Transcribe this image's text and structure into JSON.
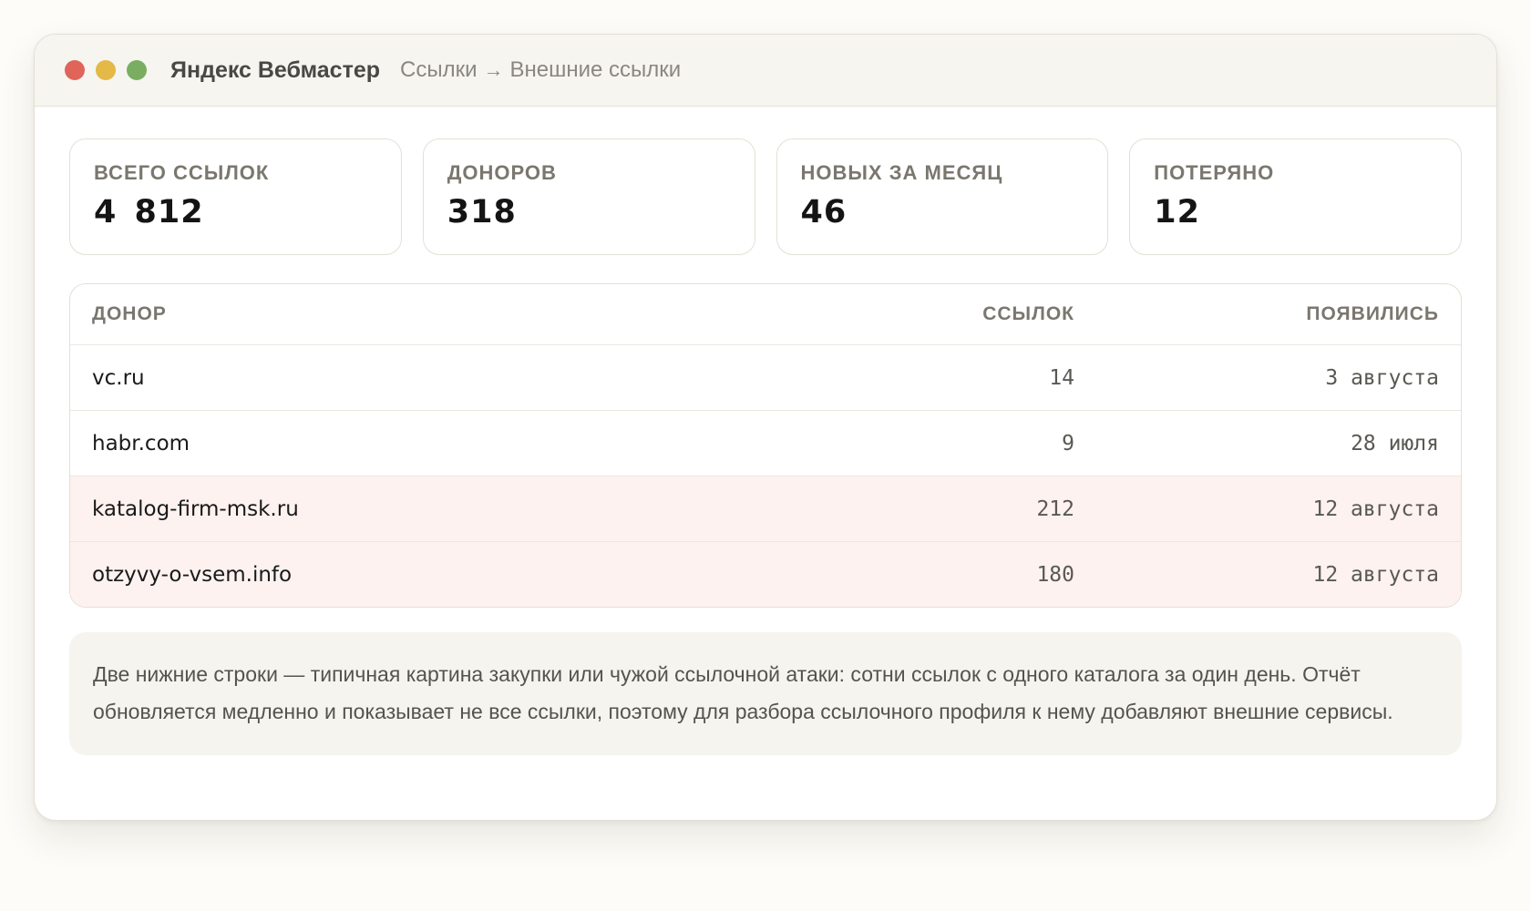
{
  "window": {
    "controls": [
      "close",
      "minimize",
      "maximize"
    ],
    "app_title": "Яндекс Вебмастер",
    "breadcrumb": {
      "parent": "Ссылки",
      "arrow": "→",
      "current": "Внешние ссылки"
    }
  },
  "stats": [
    {
      "label": "Всего ссылок",
      "value": "4 812"
    },
    {
      "label": "Доноров",
      "value": "318"
    },
    {
      "label": "Новых за месяц",
      "value": "46"
    },
    {
      "label": "Потеряно",
      "value": "12"
    }
  ],
  "table": {
    "headers": {
      "donor": "Донор",
      "links": "Ссылок",
      "appeared": "Появились"
    },
    "rows": [
      {
        "donor": "vc.ru",
        "links": "14",
        "appeared": "3 августа",
        "highlighted": false
      },
      {
        "donor": "habr.com",
        "links": "9",
        "appeared": "28 июля",
        "highlighted": false
      },
      {
        "donor": "katalog-firm-msk.ru",
        "links": "212",
        "appeared": "12 августа",
        "highlighted": true
      },
      {
        "donor": "otzyvy-o-vsem.info",
        "links": "180",
        "appeared": "12 августа",
        "highlighted": true
      }
    ]
  },
  "note": {
    "text": "Две нижние строки — типичная картина закупки или чужой ссылочной атаки: сотни ссылок с одного каталога за один день. Отчёт обновляется медленно и показывает не все ссылки, поэтому для разбора ссылочного профиля к нему добавляют внешние сервисы."
  },
  "colors": {
    "close": "#e0645a",
    "minimize": "#e4b947",
    "maximize": "#79ae62",
    "highlight_row": "#fdf2ef"
  }
}
